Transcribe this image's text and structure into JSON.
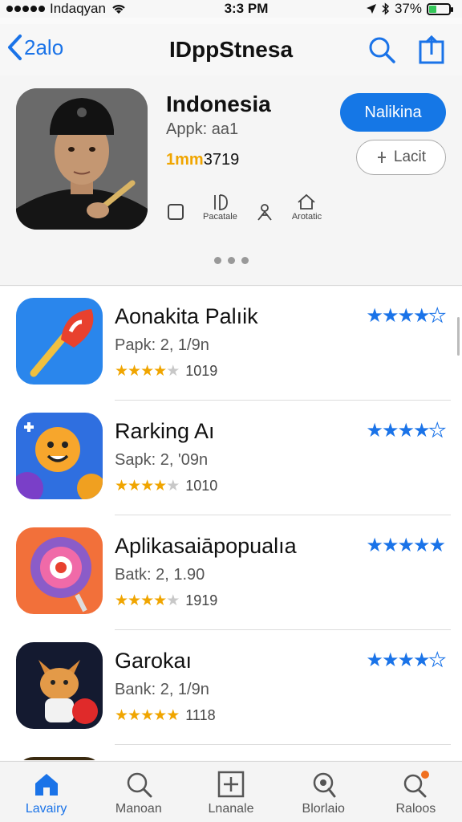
{
  "status_bar": {
    "carrier": "Indaqyan",
    "time": "3:3 PM",
    "battery": "37%",
    "battery_level": 0.37
  },
  "nav": {
    "back_label": "2alo",
    "title": "IDppStnesa"
  },
  "featured": {
    "title": "Indonesia",
    "subtitle": "Appk: aa1",
    "rating_text": "1mm",
    "rating_count": "3719",
    "primary_button": "Nalikina",
    "secondary_button": "Lacit",
    "actions": [
      {
        "icon": "square-icon",
        "label": ""
      },
      {
        "icon": "id-icon",
        "label": "Pacatale"
      },
      {
        "icon": "person-icon",
        "label": ""
      },
      {
        "icon": "home-icon",
        "label": "Arotatic"
      }
    ],
    "page_dots": 3
  },
  "apps": [
    {
      "name": "Aonakita Palıik",
      "subtitle": "Papk: 2, 1/9n",
      "rating": 3.5,
      "count": "1019",
      "right_stars": 4.5,
      "icon": "popsicle-icon",
      "color_a": "#2d8ef0",
      "color_b": "#1a5fd0"
    },
    {
      "name": "Rarking Aı",
      "subtitle": "Sapk: 2, '09n",
      "rating": 3.5,
      "count": "1010",
      "right_stars": 4.5,
      "icon": "smiley-sun-icon",
      "color_a": "#3c8ff0",
      "color_b": "#2554c8"
    },
    {
      "name": "Aplikasaiāpopualıa",
      "subtitle": "Batk: 2, 1.90",
      "rating": 3.5,
      "count": "1919",
      "right_stars": 5,
      "icon": "lollipop-icon",
      "color_a": "#f58a3a",
      "color_b": "#e8412e"
    },
    {
      "name": "Garokaı",
      "subtitle": "Bank: 2, 1/9n",
      "rating": 4.5,
      "count": "1118",
      "right_stars": 4.5,
      "icon": "fox-icon",
      "color_a": "#1a2238",
      "color_b": "#0d1020"
    }
  ],
  "tabs": [
    {
      "label": "Lavairy",
      "icon": "home-icon",
      "active": true
    },
    {
      "label": "Manoan",
      "icon": "search-icon",
      "active": false
    },
    {
      "label": "Lnanale",
      "icon": "add-square-icon",
      "active": false
    },
    {
      "label": "Blorlaio",
      "icon": "magnifier-icon",
      "active": false
    },
    {
      "label": "Raloos",
      "icon": "search-badge-icon",
      "active": false
    }
  ],
  "colors": {
    "accent": "#1a73e8",
    "star_gold": "#f0a500",
    "button_blue": "#1577e6"
  }
}
